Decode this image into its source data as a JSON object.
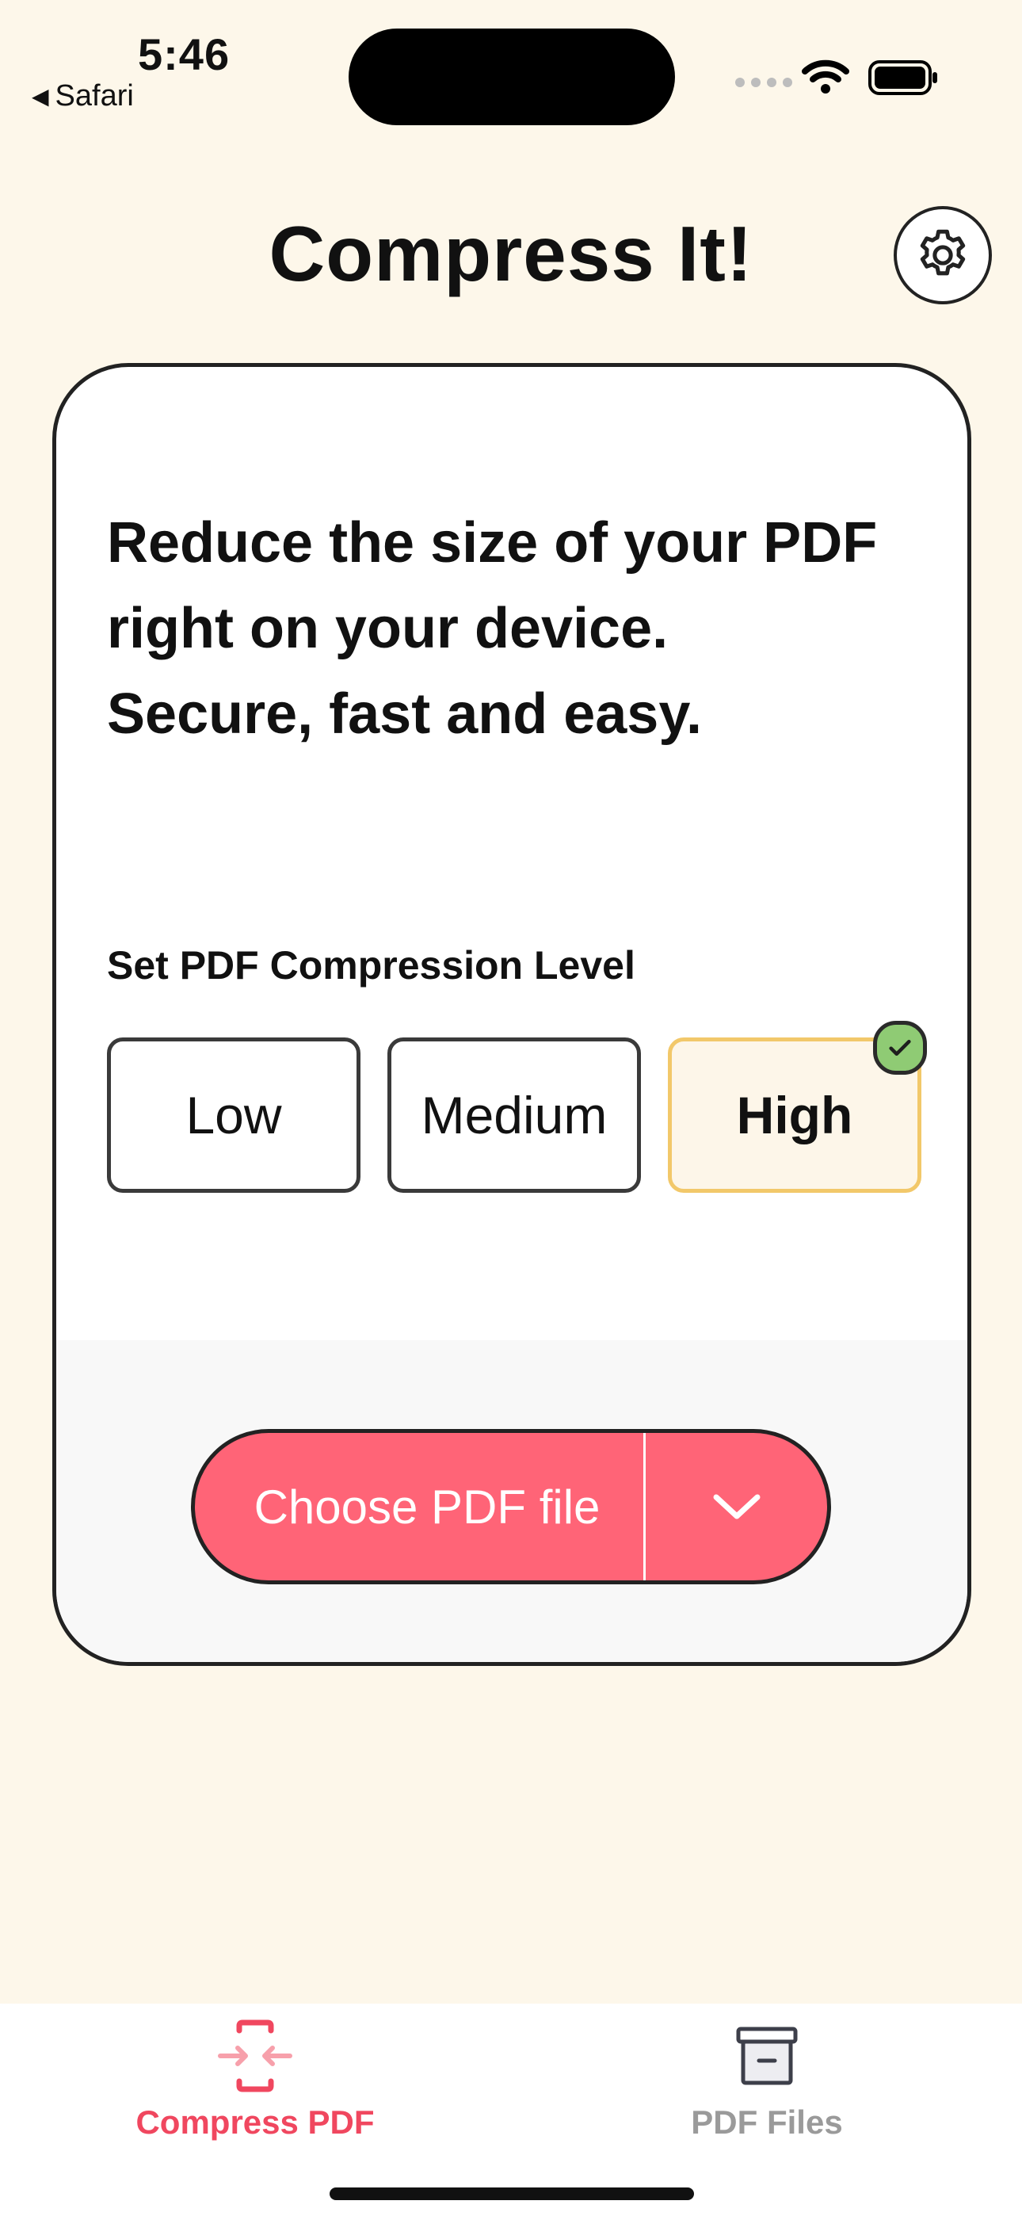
{
  "status_bar": {
    "time": "5:46",
    "back_app": "Safari",
    "back_arrow": "◀"
  },
  "header": {
    "title": "Compress It!",
    "settings_icon": "gear-icon"
  },
  "card": {
    "description_lines": [
      "Reduce the size of your PDF",
      "right on your device.",
      "Secure, fast and easy."
    ],
    "level_label": "Set PDF Compression Level",
    "levels": [
      {
        "label": "Low",
        "selected": false
      },
      {
        "label": "Medium",
        "selected": false
      },
      {
        "label": "High",
        "selected": true
      }
    ],
    "choose_button": {
      "label": "Choose PDF file",
      "dropdown_icon": "chevron-down-icon"
    }
  },
  "tab_bar": {
    "tabs": [
      {
        "label": "Compress PDF",
        "icon": "compress-icon",
        "active": true
      },
      {
        "label": "PDF Files",
        "icon": "archive-box-icon",
        "active": false
      }
    ]
  },
  "colors": {
    "background": "#fdf7ea",
    "accent": "#ff6477",
    "selected_border": "#f2c86a",
    "check_green": "#8fcb74",
    "active_tab": "#f0475f",
    "inactive_tab": "#9a9a9a"
  }
}
